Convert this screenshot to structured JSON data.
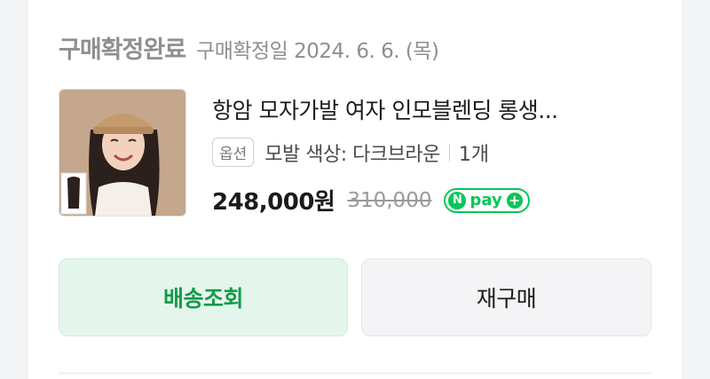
{
  "order": {
    "status": "구매확정완료",
    "date_text": "구매확정일 2024. 6. 6. (목)"
  },
  "product": {
    "name": "항암 모자가발 여자 인모블렌딩 롱생...",
    "option_badge": "옵션",
    "option_text": "모발 색상: 다크브라운",
    "quantity": "1개",
    "price": "248,000원",
    "original_price": "310,000",
    "npay": {
      "n": "N",
      "word": "pay",
      "plus": "+"
    }
  },
  "actions": {
    "track_label": "배송조회",
    "reorder_label": "재구매"
  },
  "colors": {
    "accent_green": "#03c75a",
    "track_bg": "#e4f6ec",
    "track_text": "#159a4d"
  }
}
